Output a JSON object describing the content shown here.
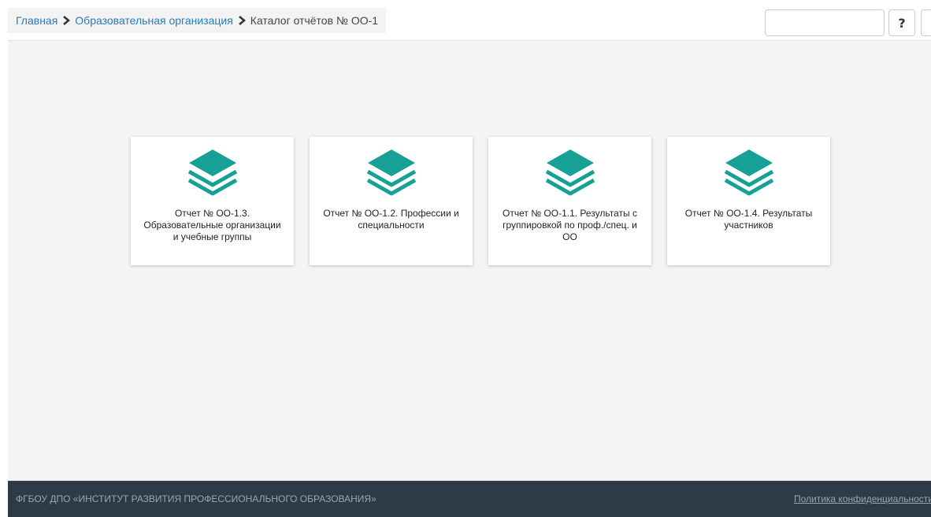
{
  "breadcrumb": {
    "home": "Главная",
    "org": "Образовательная организация",
    "current": "Каталог отчётов № ОО-1"
  },
  "header": {
    "search_value": "",
    "help_label": "?"
  },
  "cards": [
    {
      "label": "Отчет № ОО-1.3. Образовательные организации и учебные группы",
      "icon": "layers-icon"
    },
    {
      "label": "Отчет № ОО-1.2. Профессии и специальности",
      "icon": "layers-icon"
    },
    {
      "label": "Отчет № ОО-1.1. Результаты с группировкой по проф./спец. и ОО",
      "icon": "layers-icon"
    },
    {
      "label": "Отчет № ОО-1.4. Результаты участников",
      "icon": "layers-icon"
    }
  ],
  "footer": {
    "org": "ФГБОУ ДПО «ИНСТИТУТ РАЗВИТИЯ ПРОФЕССИОНАЛЬНОГО ОБРАЗОВАНИЯ»",
    "policy": "Политика конфиденциальности"
  },
  "colors": {
    "accent": "#16a096",
    "link": "#2a7ab8",
    "footer_bg": "#2e3a45",
    "page_bg": "#f4f4f4"
  }
}
